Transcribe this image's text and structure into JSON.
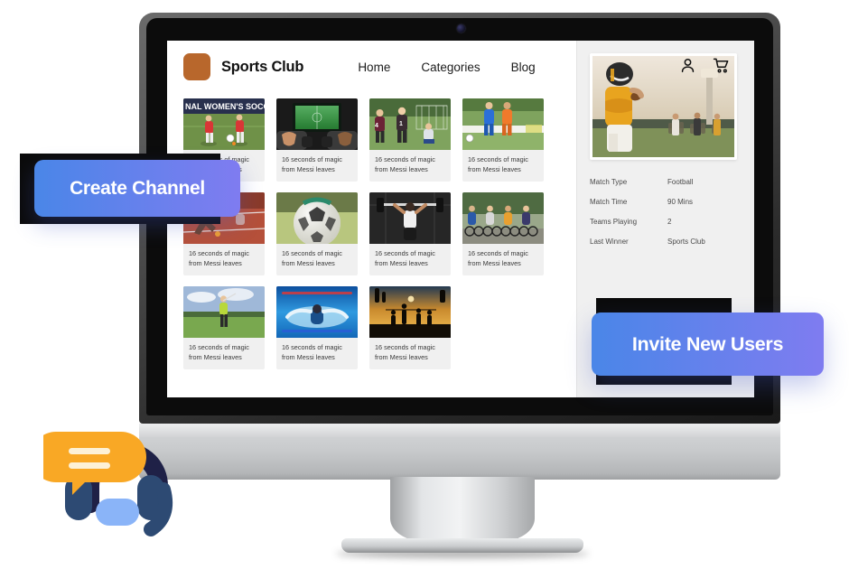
{
  "header": {
    "brand_name": "Sports Club",
    "logo_color": "#b8672c",
    "nav": [
      {
        "label": "Home"
      },
      {
        "label": "Categories"
      },
      {
        "label": "Blog"
      }
    ],
    "icons": [
      {
        "name": "user-icon"
      },
      {
        "name": "cart-icon"
      }
    ]
  },
  "main": {
    "cards": [
      {
        "caption": "16 seconds of magic from Messi leaves",
        "image": "womens-soccer-match"
      },
      {
        "caption": "16 seconds of magic from Messi leaves",
        "image": "mobile-gaming-controllers"
      },
      {
        "caption": "16 seconds of magic from Messi leaves",
        "image": "youth-soccer-goal"
      },
      {
        "caption": "16 seconds of magic from Messi leaves",
        "image": "soccer-header-duel"
      },
      {
        "caption": "16 seconds of magic from Messi leaves",
        "image": "track-sprint-start"
      },
      {
        "caption": "16 seconds of magic from Messi leaves",
        "image": "soccer-ball-closeup"
      },
      {
        "caption": "16 seconds of magic from Messi leaves",
        "image": "weightlifting-gym"
      },
      {
        "caption": "16 seconds of magic from Messi leaves",
        "image": "cycling-peloton"
      },
      {
        "caption": "16 seconds of magic from Messi leaves",
        "image": "golf-swing-course"
      },
      {
        "caption": "16 seconds of magic from Messi leaves",
        "image": "swimming-butterfly"
      },
      {
        "caption": "16 seconds of magic from Messi leaves",
        "image": "beach-volleyball-sunset"
      }
    ]
  },
  "sidebar": {
    "feature_image": "american-football-quarterback",
    "specs": [
      {
        "key": "Match Type",
        "value": "Football"
      },
      {
        "key": "Match Time",
        "value": "90 Mins"
      },
      {
        "key": "Teams Playing",
        "value": "2"
      },
      {
        "key": "Last Winner",
        "value": "Sports Club"
      }
    ]
  },
  "cta": {
    "create_channel": "Create Channel",
    "invite_new_users": "Invite New Users",
    "gradient_start": "#4a86e8",
    "gradient_end": "#7f7cf0"
  },
  "decor": {
    "headset_icon": "support-headset-icon",
    "bubble_color": "#f9a825",
    "headset_dark": "#1f2147",
    "headset_mid": "#2d4a73",
    "accent_light": "#8ab4f8"
  }
}
